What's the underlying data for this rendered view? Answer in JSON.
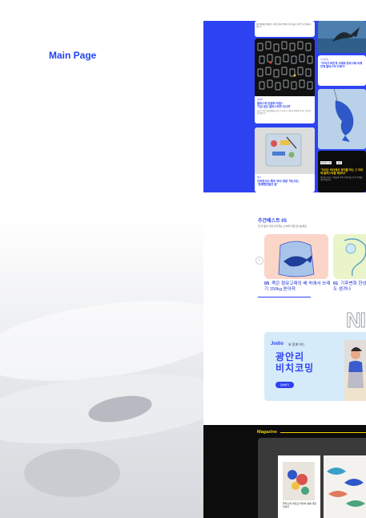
{
  "page_title": "Main Page",
  "feed": {
    "top_card_text": "해양생태를 위협하는 해양쓰레기 중에서 특히 플라스틱은 잘 분해되지 않는다",
    "card_whale": {
      "tag": "브라운계",
      "title": "\"우리가 버린게 고래와 장로고래 속에 안에 플라스틱 쓰레기\"",
      "body": "고래가 먹은 플라스틱 쓰레기에 대한 기사"
    },
    "card_plastic": {
      "tag": "이야기",
      "title": "플라스틱 컨셉의 비밀?\n'지금 같은 플라스틱의 지나쳐'",
      "body": "플라스틱이 일상생활에 널리 쓰이게 된 과정과 환경에 미치는 영향을 살펴봅니다"
    },
    "card_bottom": {
      "tag": "생각",
      "title": "이러면서도 해마 '바다 정말' 착는다는\n\"함께했던물건 잘\"",
      "body": ""
    },
    "card_dark": {
      "tag1": "비대한도배",
      "tag2": "생각",
      "title": "\"우리는 바다에서 정치를 하는 그 자리에 플라스틱을 해양다!\"",
      "body": "바다를 지키는 사람들의 이야기 해양 플라스틱 문제를 이야기합니다"
    }
  },
  "weekly_best": {
    "title": "주간베스트 05",
    "subtitle": "한 주 동안 가장 인기있는 소식을 지금 만나보세요",
    "prev_icon": "chevron-left-icon",
    "items": [
      {
        "rank": "05",
        "caption": "죽은 향유고래의 배 속에서 쓰레기 150kg 쏟아져",
        "bg": "#fbd5c8"
      },
      {
        "rank": "01",
        "caption": "기후변화 한상, 해양에서도 생겨나",
        "bg": "#e9f5c9"
      }
    ]
  },
  "promo_banner": {
    "big_letters": "NI",
    "logo": "Jodio",
    "lead": "와 함께 하는",
    "title_line1": "광안리",
    "title_line2": "비치코밍",
    "button": "참여하기"
  },
  "magazine": {
    "title": "Magazine",
    "caption": "플라스틱 아트로 바다와 새를 대한 이야기"
  },
  "colors": {
    "brand_blue": "#2d43f2",
    "magazine_yellow": "#f5d20a"
  }
}
